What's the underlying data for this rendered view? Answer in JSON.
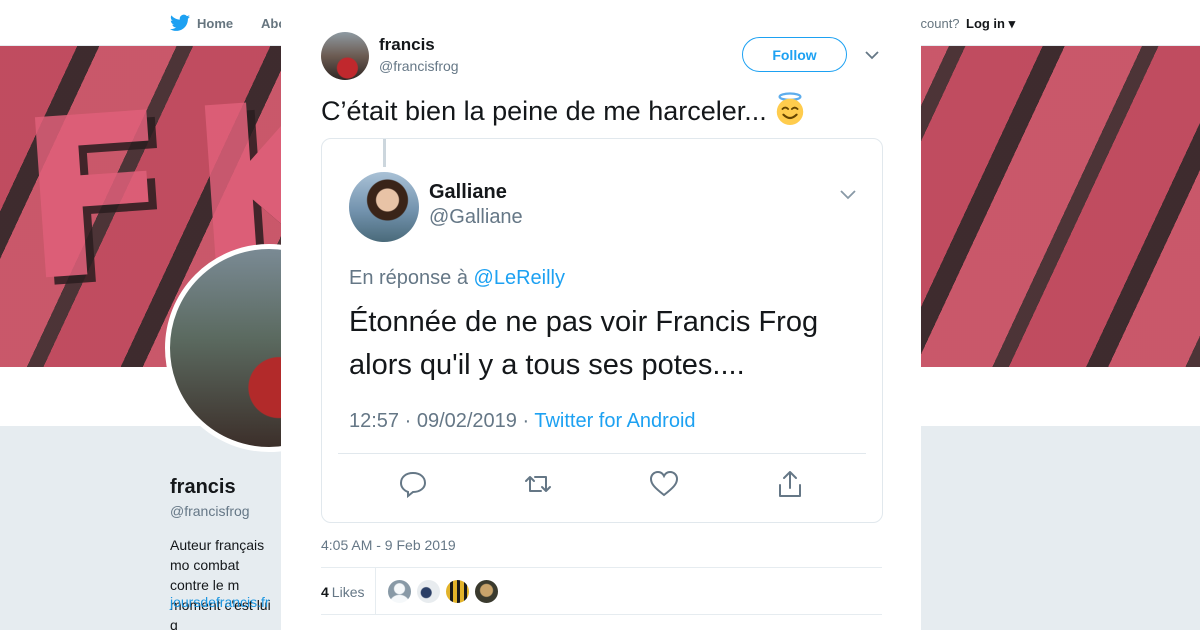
{
  "background": {
    "nav": {
      "home": "Home",
      "about": "Abo",
      "account_prompt": "ccount?",
      "login": "Log in"
    },
    "banner_letters": "FKS",
    "profile": {
      "name": "francis",
      "handle": "@francisfrog",
      "bio": "Auteur français mo combat contre le m moment c'est lui q",
      "link": "joursdefrancis.fr"
    }
  },
  "modal": {
    "author": {
      "name": "francis",
      "handle": "@francisfrog"
    },
    "follow_label": "Follow",
    "tweet_text": "C’était bien la peine de me harceler...",
    "embedded": {
      "name": "Galliane",
      "handle": "@Galliane",
      "reply_prefix": "En réponse à",
      "reply_to": "@LeReilly",
      "text": "Étonnée de ne pas voir Francis Frog alors qu'il y a tous ses potes....",
      "time": "12:57 · 09/02/2019 ·",
      "source": "Twitter for Android"
    },
    "timestamp": "4:05 AM - 9 Feb 2019",
    "likes_count": "4",
    "likes_label": "Likes"
  },
  "colors": {
    "accent": "#1da1f2",
    "muted": "#657786"
  },
  "icons": [
    "twitter-bird-icon",
    "close-icon",
    "chevron-down-icon",
    "smiling-halo-emoji",
    "reply-icon",
    "retweet-icon",
    "heart-icon",
    "share-icon"
  ]
}
